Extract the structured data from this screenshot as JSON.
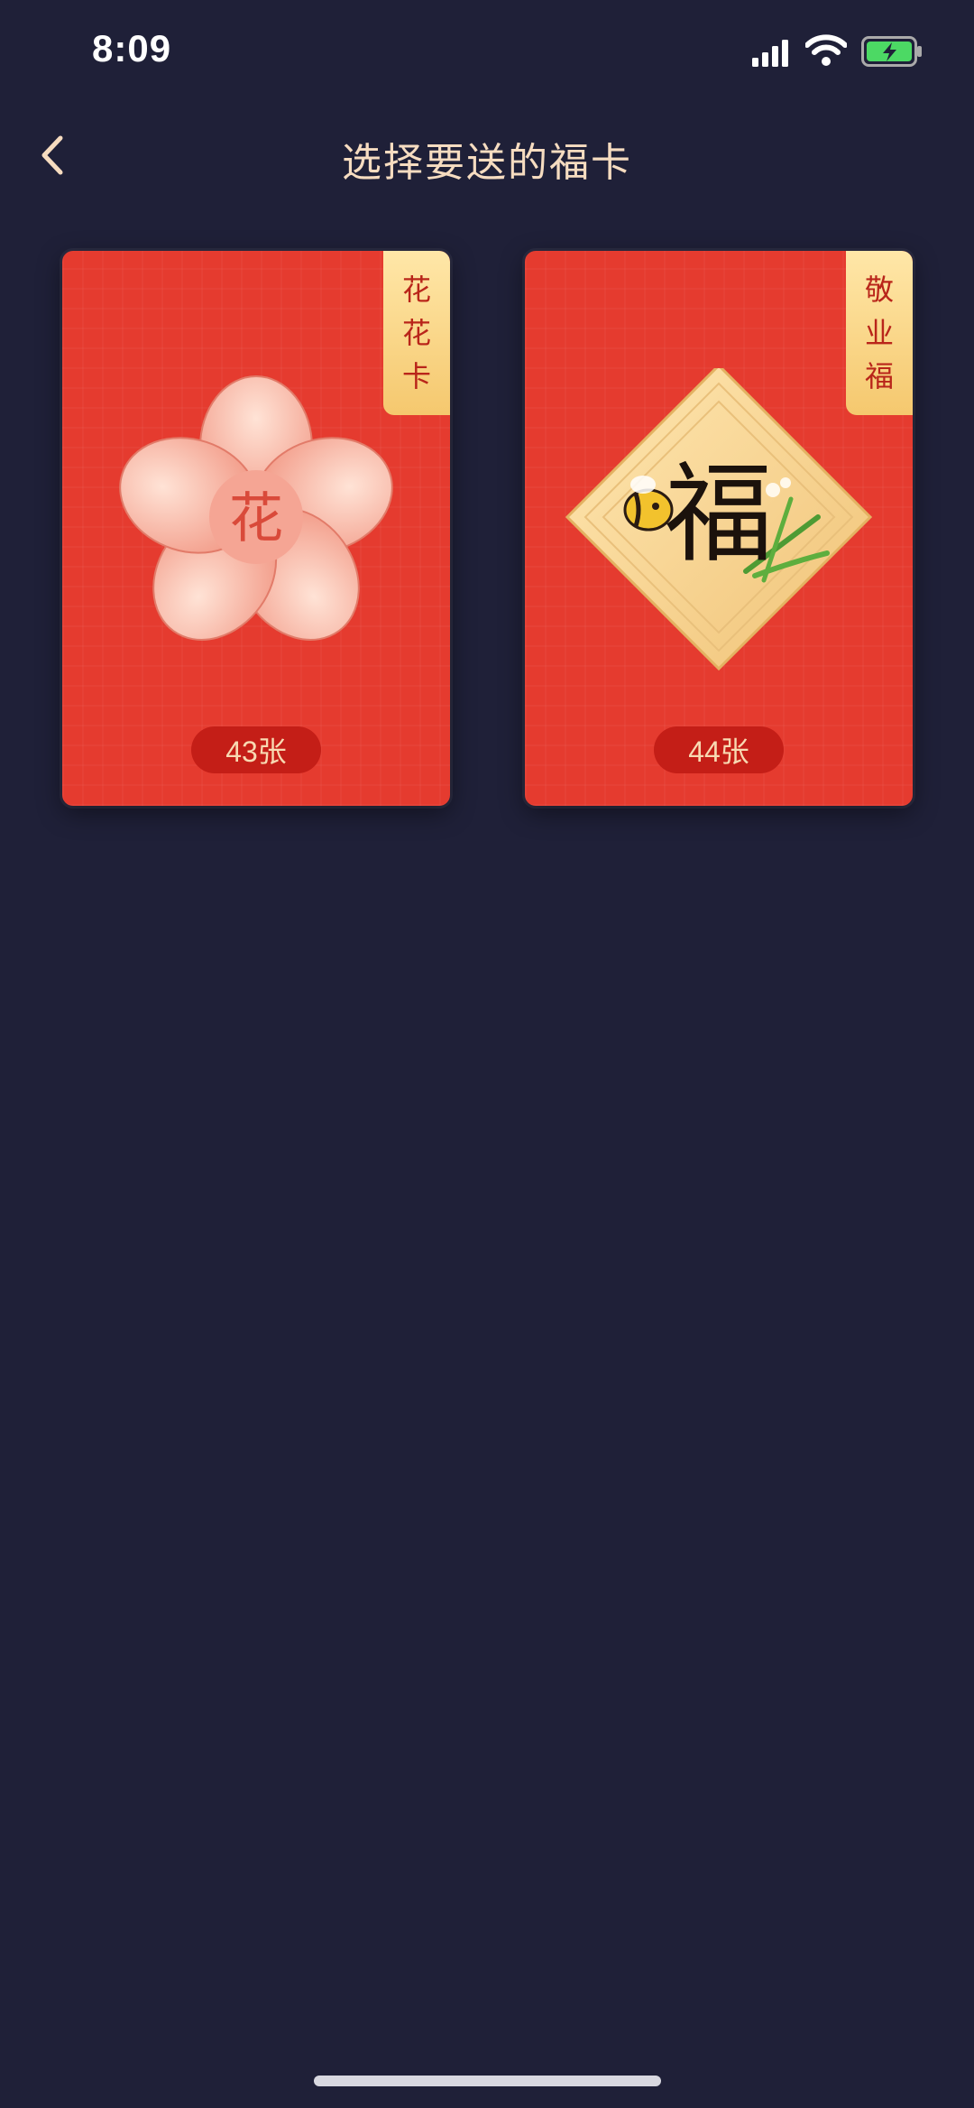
{
  "status_bar": {
    "time": "8:09",
    "icons": [
      "signal-icon",
      "wifi-icon",
      "battery-charging-icon"
    ]
  },
  "header": {
    "back_icon": "chevron-left-icon",
    "title": "选择要送的福卡"
  },
  "cards": [
    {
      "tag_chars": [
        "花",
        "花",
        "卡"
      ],
      "art_char": "花",
      "count": "43张",
      "art": "plum-blossom"
    },
    {
      "tag_chars": [
        "敬",
        "业",
        "福"
      ],
      "art_char": "福",
      "count": "44张",
      "art": "fu-diamond-with-bee-and-orchid"
    }
  ],
  "colors": {
    "background": "#1f2038",
    "card_red": "#e53b2f",
    "tag_gold": "#f5c86e",
    "title_text": "#f6dcc0",
    "battery_green": "#4cd964"
  }
}
